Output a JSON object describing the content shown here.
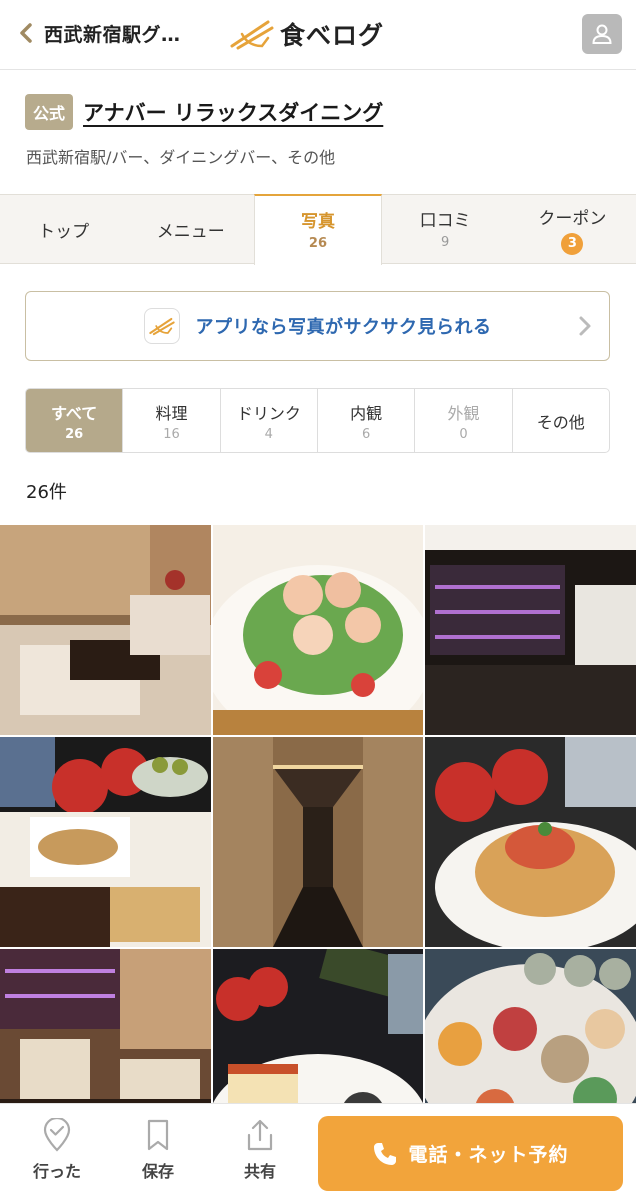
{
  "header": {
    "back_label": "西武新宿駅グ…",
    "logo_text": "食べログ"
  },
  "restaurant": {
    "official_badge": "公式",
    "name": "アナバー リラックスダイニング",
    "genre": "西武新宿駅/バー、ダイニングバー、その他"
  },
  "tabs": [
    {
      "label": "トップ",
      "count": ""
    },
    {
      "label": "メニュー",
      "count": ""
    },
    {
      "label": "写真",
      "count": "26",
      "active": true
    },
    {
      "label": "口コミ",
      "count": "9"
    },
    {
      "label": "クーポン",
      "badge": "3"
    }
  ],
  "app_banner": {
    "text": "アプリなら写真がサクサク見られる"
  },
  "filters": [
    {
      "label": "すべて",
      "count": "26",
      "active": true
    },
    {
      "label": "料理",
      "count": "16"
    },
    {
      "label": "ドリンク",
      "count": "4"
    },
    {
      "label": "内観",
      "count": "6"
    },
    {
      "label": "外観",
      "count": "0",
      "disabled": true
    },
    {
      "label": "その他",
      "count": ""
    }
  ],
  "result_count": "26件",
  "bottom_bar": {
    "went_label": "行った",
    "save_label": "保存",
    "share_label": "共有",
    "reserve_label": "電話・ネット予約"
  },
  "colors": {
    "accent": "#f2a43b",
    "official": "#b7ab8d",
    "link": "#2e68b0"
  }
}
